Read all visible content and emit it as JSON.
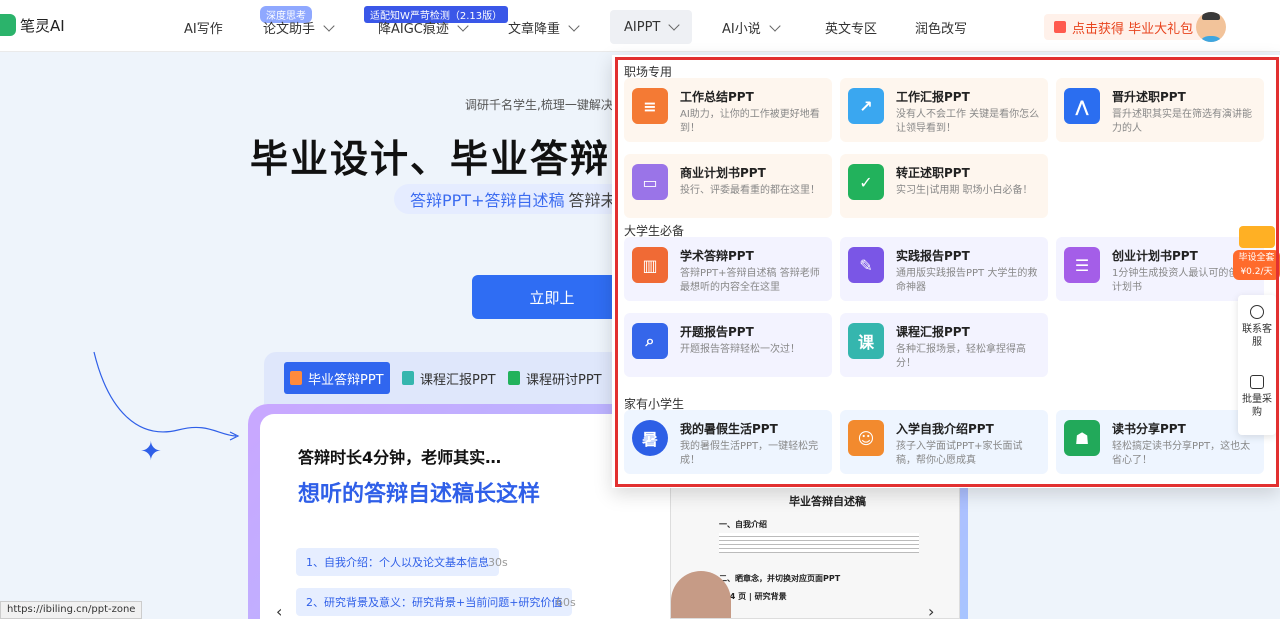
{
  "nav": {
    "logo": "笔灵AI",
    "items": [
      {
        "label": "AI写作",
        "chevron": false
      },
      {
        "label": "论文助手",
        "chevron": true
      },
      {
        "label": "降AIGC痕迹",
        "chevron": true
      },
      {
        "label": "文章降重",
        "chevron": true
      },
      {
        "label": "AIPPT",
        "chevron": true
      },
      {
        "label": "AI小说",
        "chevron": true
      },
      {
        "label": "英文专区",
        "chevron": false
      },
      {
        "label": "润色改写",
        "chevron": false
      }
    ],
    "badge_deep": "深度思考",
    "badge_aigc": "适配知W严苛检测（2.13版）",
    "gift": "点击获得 毕业大礼包"
  },
  "hero": {
    "subtitle": "调研千名学生,梳理一键解决",
    "title": "毕业设计、毕业答辩",
    "pill_blue": "答辩PPT+答辩自述稿",
    "pill_grey": "答辩未",
    "upload": "立即上"
  },
  "tabs": [
    "毕业答辩PPT",
    "课程汇报PPT",
    "课程研讨PPT"
  ],
  "stage": {
    "line1": "答辩时长4分钟，老师其实…",
    "line2": "想听的答辩自述稿长这样",
    "steps": [
      {
        "label": "1、自我介绍：个人以及论文基本信息",
        "time": "30s"
      },
      {
        "label": "2、研究背景及意义：研究背景+当前问题+研究价值",
        "time": "60s"
      }
    ],
    "doc_title": "毕业答辩自述稿",
    "doc_sec1": "一、自我介绍",
    "doc_sec2": "二、晒章念，并切换对应页面PPT",
    "doc_sec3": "第 4 页 | 研究背景"
  },
  "dropdown": {
    "sections": [
      {
        "title": "职场专用",
        "cards": [
          {
            "title": "工作总结PPT",
            "desc": "AI助力，让你的工作被更好地看到！",
            "icon": "report-icon",
            "color": "#f47a34",
            "bg": "orange"
          },
          {
            "title": "工作汇报PPT",
            "desc": "没有人不会工作 关键是看你怎么让领导看到！",
            "icon": "chart-doc-icon",
            "color": "#3aa7f0",
            "bg": "orange"
          },
          {
            "title": "晋升述职PPT",
            "desc": "晋升述职其实是在筛选有演讲能力的人",
            "icon": "trend-icon",
            "color": "#2b6ef0",
            "bg": "orange"
          },
          {
            "title": "商业计划书PPT",
            "desc": "投行、评委最看重的都在这里！",
            "icon": "briefcase-icon",
            "color": "#9a74e8",
            "bg": "orange"
          },
          {
            "title": "转正述职PPT",
            "desc": "实习生|试用期 职场小白必备！",
            "icon": "checklist-icon",
            "color": "#22b25c",
            "bg": "orange"
          }
        ]
      },
      {
        "title": "大学生必备",
        "cards": [
          {
            "title": "学术答辩PPT",
            "desc": "答辩PPT+答辩自述稿 答辩老师最想听的内容全在这里",
            "icon": "book-icon",
            "color": "#f06a35",
            "bg": "purple"
          },
          {
            "title": "实践报告PPT",
            "desc": "通用版实践报告PPT 大学生的救命神器",
            "icon": "edit-doc-icon",
            "color": "#7a56e6",
            "bg": "purple"
          },
          {
            "title": "创业计划书PPT",
            "desc": "1分钟生成投资人最认可的创业计划书",
            "icon": "clipboard-icon",
            "color": "#a45ee8",
            "bg": "purple"
          },
          {
            "title": "开题报告PPT",
            "desc": "开题报告答辩轻松一次过！",
            "icon": "search-doc-icon",
            "color": "#3566ea",
            "bg": "purple"
          },
          {
            "title": "课程汇报PPT",
            "desc": "各种汇报场景，轻松拿捏得高分！",
            "icon": "course-icon",
            "color": "#35b6ae",
            "bg": "purple"
          }
        ]
      },
      {
        "title": "家有小学生",
        "cards": [
          {
            "title": "我的暑假生活PPT",
            "desc": "我的暑假生活PPT，一键轻松完成！",
            "icon": "summer-icon",
            "glyph": "暑",
            "color": "#2d5fe6",
            "bg": "blue"
          },
          {
            "title": "入学自我介绍PPT",
            "desc": "孩子入学面试PPT+家长面试稿，帮你心愿成真",
            "icon": "student-icon",
            "color": "#f28a2e",
            "bg": "blue"
          },
          {
            "title": "读书分享PPT",
            "desc": "轻松搞定读书分享PPT，这也太省心了！",
            "icon": "reading-icon",
            "color": "#22a95a",
            "bg": "blue"
          }
        ]
      }
    ]
  },
  "float": {
    "gift_text": "毕设全套 ¥0.2/天",
    "service": "联系客服",
    "bulk": "批量采购"
  },
  "status_url": "https://ibiling.cn/ppt-zone"
}
